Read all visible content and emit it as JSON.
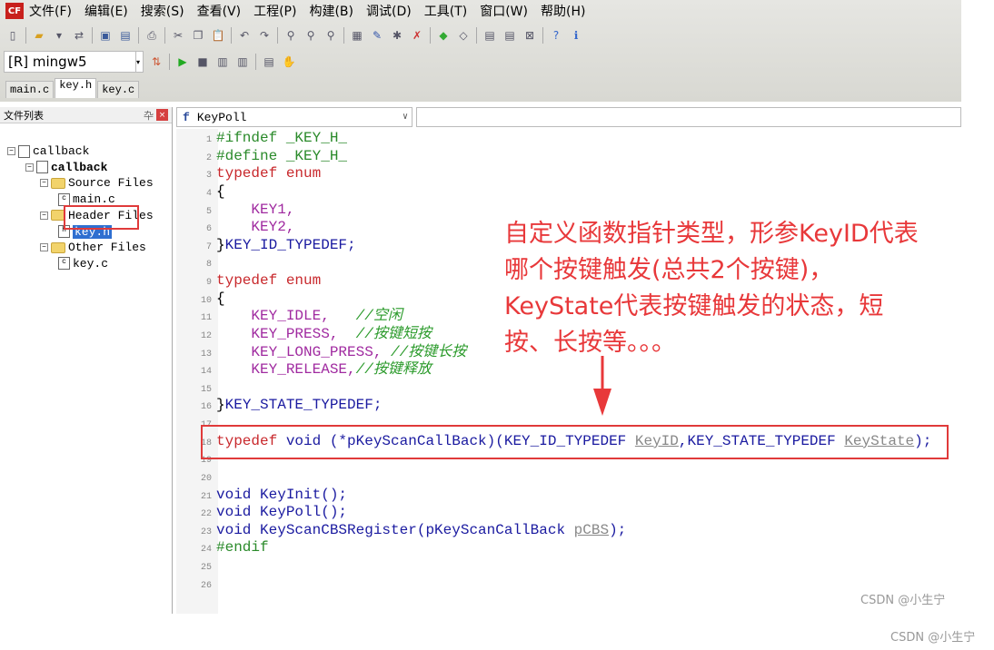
{
  "menu": {
    "logo": "CF",
    "items": [
      "文件(F)",
      "编辑(E)",
      "搜索(S)",
      "查看(V)",
      "工程(P)",
      "构建(B)",
      "调试(D)",
      "工具(T)",
      "窗口(W)",
      "帮助(H)"
    ]
  },
  "toolbar": {
    "compiler": "[R] mingw5"
  },
  "tabs": [
    {
      "label": "main.c",
      "active": false
    },
    {
      "label": "key.h",
      "active": true
    },
    {
      "label": "key.c",
      "active": false
    }
  ],
  "sidebar": {
    "title": "文件列表",
    "tree": [
      {
        "label": "callback",
        "level": 0
      },
      {
        "label": "callback",
        "level": 1,
        "bold": true
      },
      {
        "label": "Source Files",
        "level": 2,
        "type": "folder"
      },
      {
        "label": "main.c",
        "level": 3,
        "type": "file"
      },
      {
        "label": "Header Files",
        "level": 2,
        "type": "folder"
      },
      {
        "label": "key.h",
        "level": 3,
        "type": "file",
        "selected": true
      },
      {
        "label": "Other Files",
        "level": 2,
        "type": "folder"
      },
      {
        "label": "key.c",
        "level": 3,
        "type": "file"
      }
    ]
  },
  "editor": {
    "function": "KeyPoll",
    "lines": [
      [
        [
          "pp",
          "#ifndef _KEY_H_"
        ]
      ],
      [
        [
          "pp",
          "#define _KEY_H_"
        ]
      ],
      [
        [
          "kw",
          "typedef enum"
        ]
      ],
      [
        [
          "tx",
          "{"
        ]
      ],
      [
        [
          "en",
          "    KEY1,"
        ]
      ],
      [
        [
          "en",
          "    KEY2,"
        ]
      ],
      [
        [
          "tx",
          "}"
        ],
        [
          "ty",
          "KEY_ID_TYPEDEF;"
        ]
      ],
      [],
      [
        [
          "kw",
          "typedef enum"
        ]
      ],
      [
        [
          "tx",
          "{"
        ]
      ],
      [
        [
          "en",
          "    KEY_IDLE,   "
        ],
        [
          "cm",
          "//空闲"
        ]
      ],
      [
        [
          "en",
          "    KEY_PRESS,  "
        ],
        [
          "cm",
          "//按键短按"
        ]
      ],
      [
        [
          "en",
          "    KEY_LONG_PRESS, "
        ],
        [
          "cm",
          "//按键长按"
        ]
      ],
      [
        [
          "en",
          "    KEY_RELEASE,"
        ],
        [
          "cm",
          "//按键释放"
        ]
      ],
      [],
      [
        [
          "tx",
          "}"
        ],
        [
          "ty",
          "KEY_STATE_TYPEDEF;"
        ]
      ],
      [],
      [
        [
          "kw",
          "typedef "
        ],
        [
          "ty",
          "void (*pKeyScanCallBack)(KEY_ID_TYPEDEF "
        ],
        [
          "pa",
          "KeyID"
        ],
        [
          "ty",
          ",KEY_STATE_TYPEDEF "
        ],
        [
          "pa",
          "KeyState"
        ],
        [
          "ty",
          ");"
        ]
      ],
      [],
      [],
      [
        [
          "ty",
          "void KeyInit();"
        ]
      ],
      [
        [
          "ty",
          "void KeyPoll();"
        ]
      ],
      [
        [
          "ty",
          "void KeyScanCBSRegister(pKeyScanCallBack "
        ],
        [
          "pa",
          "pCBS"
        ],
        [
          "ty",
          ");"
        ]
      ],
      [
        [
          "pp",
          "#endif"
        ]
      ],
      [],
      []
    ]
  },
  "annotation": {
    "lines": [
      "自定义函数指针类型，形参KeyID代表",
      "哪个按键触发(总共2个按键)，",
      "KeyState代表按键触发的状态，短",
      "按、长按等。。。"
    ],
    "color": "#e8383a"
  },
  "watermarks": [
    "CSDN @小生宁",
    "CSDN @小生宁"
  ]
}
